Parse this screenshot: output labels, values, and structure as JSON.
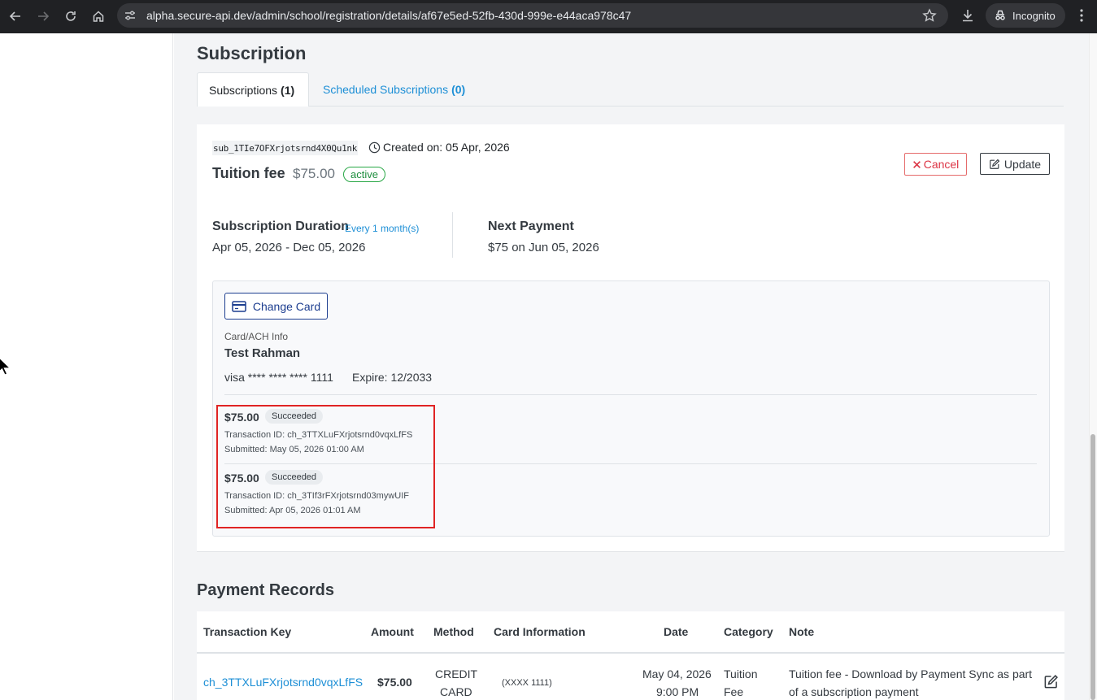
{
  "browser": {
    "url": "alpha.secure-api.dev/admin/school/registration/details/af67e5ed-52fb-430d-999e-e44aca978c47",
    "profile_label": "Incognito"
  },
  "subscription_section": {
    "title": "Subscription",
    "tabs": [
      {
        "label": "Subscriptions",
        "count": "(1)",
        "active": true
      },
      {
        "label": "Scheduled Subscriptions",
        "count": "(0)",
        "active": false
      }
    ]
  },
  "subscription": {
    "id": "sub_1TIe7OFXrjotsrnd4X0Qu1nk",
    "created": "Created on: 05 Apr, 2026",
    "plan_name": "Tuition fee",
    "price": "$75.00",
    "status": "active",
    "cancel_label": "Cancel",
    "update_label": "Update",
    "duration_label": "Subscription Duration",
    "duration_frequency": "Every 1 month(s)",
    "duration_value": "Apr 05, 2026 - Dec 05, 2026",
    "next_payment_label": "Next Payment",
    "next_payment_value": "$75 on Jun 05, 2026"
  },
  "card": {
    "change_label": "Change Card",
    "info_label": "Card/ACH Info",
    "holder": "Test Rahman",
    "number": "visa **** **** **** 1111",
    "expire": "Expire: 12/2033"
  },
  "transactions": [
    {
      "amount": "$75.00",
      "status": "Succeeded",
      "id": "Transaction ID: ch_3TTXLuFXrjotsrnd0vqxLfFS",
      "submitted": "Submitted: May 05, 2026 01:00 AM"
    },
    {
      "amount": "$75.00",
      "status": "Succeeded",
      "id": "Transaction ID: ch_3TIf3rFXrjotsrnd03mywUIF",
      "submitted": "Submitted: Apr 05, 2026 01:01 AM"
    }
  ],
  "payment_records": {
    "title": "Payment Records",
    "headers": {
      "key": "Transaction Key",
      "amount": "Amount",
      "method": "Method",
      "card": "Card Information",
      "date": "Date",
      "category": "Category",
      "note": "Note"
    },
    "rows": [
      {
        "key": "ch_3TTXLuFXrjotsrnd0vqxLfFS",
        "amount": "$75.00",
        "method_line1": "CREDIT",
        "method_line2": "CARD",
        "card": "(XXXX 1111)",
        "date_line1": "May 04, 2026",
        "date_line2": "9:00 PM",
        "category_line1": "Tuition",
        "category_line2": "Fee",
        "note_line1": "Tuition fee - Download by Payment Sync as part",
        "note_line2": "of a subscription payment"
      }
    ]
  },
  "colors": {
    "link": "#1d8fd6",
    "danger": "#dc3545",
    "success": "#28a745",
    "highlight": "#e02424",
    "primary_outline": "#1c3d8f"
  },
  "icons": [
    "back-icon",
    "forward-icon",
    "reload-icon",
    "home-icon",
    "site-info-icon",
    "star-icon",
    "download-icon",
    "incognito-icon",
    "kebab-menu-icon",
    "clock-icon",
    "close-icon",
    "edit-icon",
    "credit-card-icon",
    "mouse-cursor-icon"
  ]
}
